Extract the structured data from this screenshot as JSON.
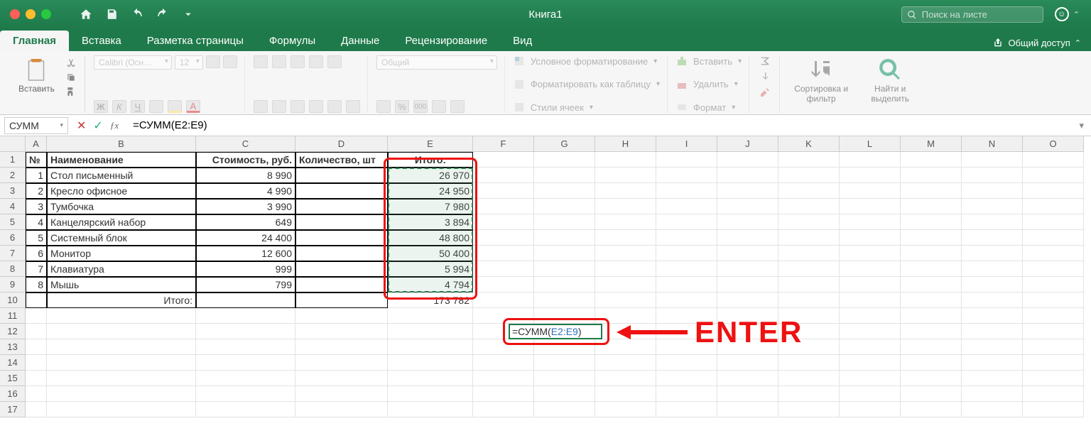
{
  "window": {
    "title": "Книга1"
  },
  "search": {
    "placeholder": "Поиск на листе"
  },
  "tabs": [
    "Главная",
    "Вставка",
    "Разметка страницы",
    "Формулы",
    "Данные",
    "Рецензирование",
    "Вид"
  ],
  "share": "Общий доступ",
  "ribbon": {
    "paste": "Вставить",
    "font_name": "Calibri (Осн…",
    "font_size": "12",
    "number_format": "Общий",
    "cond_fmt": "Условное форматирование",
    "as_table": "Форматировать как таблицу",
    "cell_styles": "Стили ячеек",
    "insert": "Вставить",
    "delete": "Удалить",
    "format": "Формат",
    "sort": "Сортировка и фильтр",
    "find": "Найти и выделить"
  },
  "namebox": "СУММ",
  "formula": "=СУММ(E2:E9)",
  "columns": [
    "A",
    "B",
    "C",
    "D",
    "E",
    "F",
    "G",
    "H",
    "I",
    "J",
    "K",
    "L",
    "M",
    "N",
    "O"
  ],
  "col_widths": [
    "cw-A",
    "cw-B",
    "cw-C",
    "cw-D",
    "cw-E",
    "cw-n",
    "cw-n",
    "cw-n",
    "cw-n",
    "cw-n",
    "cw-n",
    "cw-n",
    "cw-n",
    "cw-n",
    "cw-n"
  ],
  "headers": {
    "A": "№",
    "B": "Наименование",
    "C": "Стоимость, руб.",
    "D": "Количество, шт",
    "E": "Итого:"
  },
  "rows": [
    {
      "n": "1",
      "name": "Стол письменный",
      "cost": "8 990",
      "qty": "",
      "total": "26 970"
    },
    {
      "n": "2",
      "name": "Кресло офисное",
      "cost": "4 990",
      "qty": "",
      "total": "24 950"
    },
    {
      "n": "3",
      "name": "Тумбочка",
      "cost": "3 990",
      "qty": "",
      "total": "7 980"
    },
    {
      "n": "4",
      "name": "Канцелярский набор",
      "cost": "649",
      "qty": "",
      "total": "3 894"
    },
    {
      "n": "5",
      "name": "Системный блок",
      "cost": "24 400",
      "qty": "",
      "total": "48 800"
    },
    {
      "n": "6",
      "name": "Монитор",
      "cost": "12 600",
      "qty": "",
      "total": "50 400"
    },
    {
      "n": "7",
      "name": "Клавиатура",
      "cost": "999",
      "qty": "",
      "total": "5 994"
    },
    {
      "n": "8",
      "name": "Мышь",
      "cost": "799",
      "qty": "",
      "total": "4 794"
    }
  ],
  "footer": {
    "label": "Итого:",
    "total": "173 782"
  },
  "edit": {
    "prefix": "=СУММ(",
    "ref": "E2:E9",
    "suffix": ")"
  },
  "annotation": "ENTER"
}
